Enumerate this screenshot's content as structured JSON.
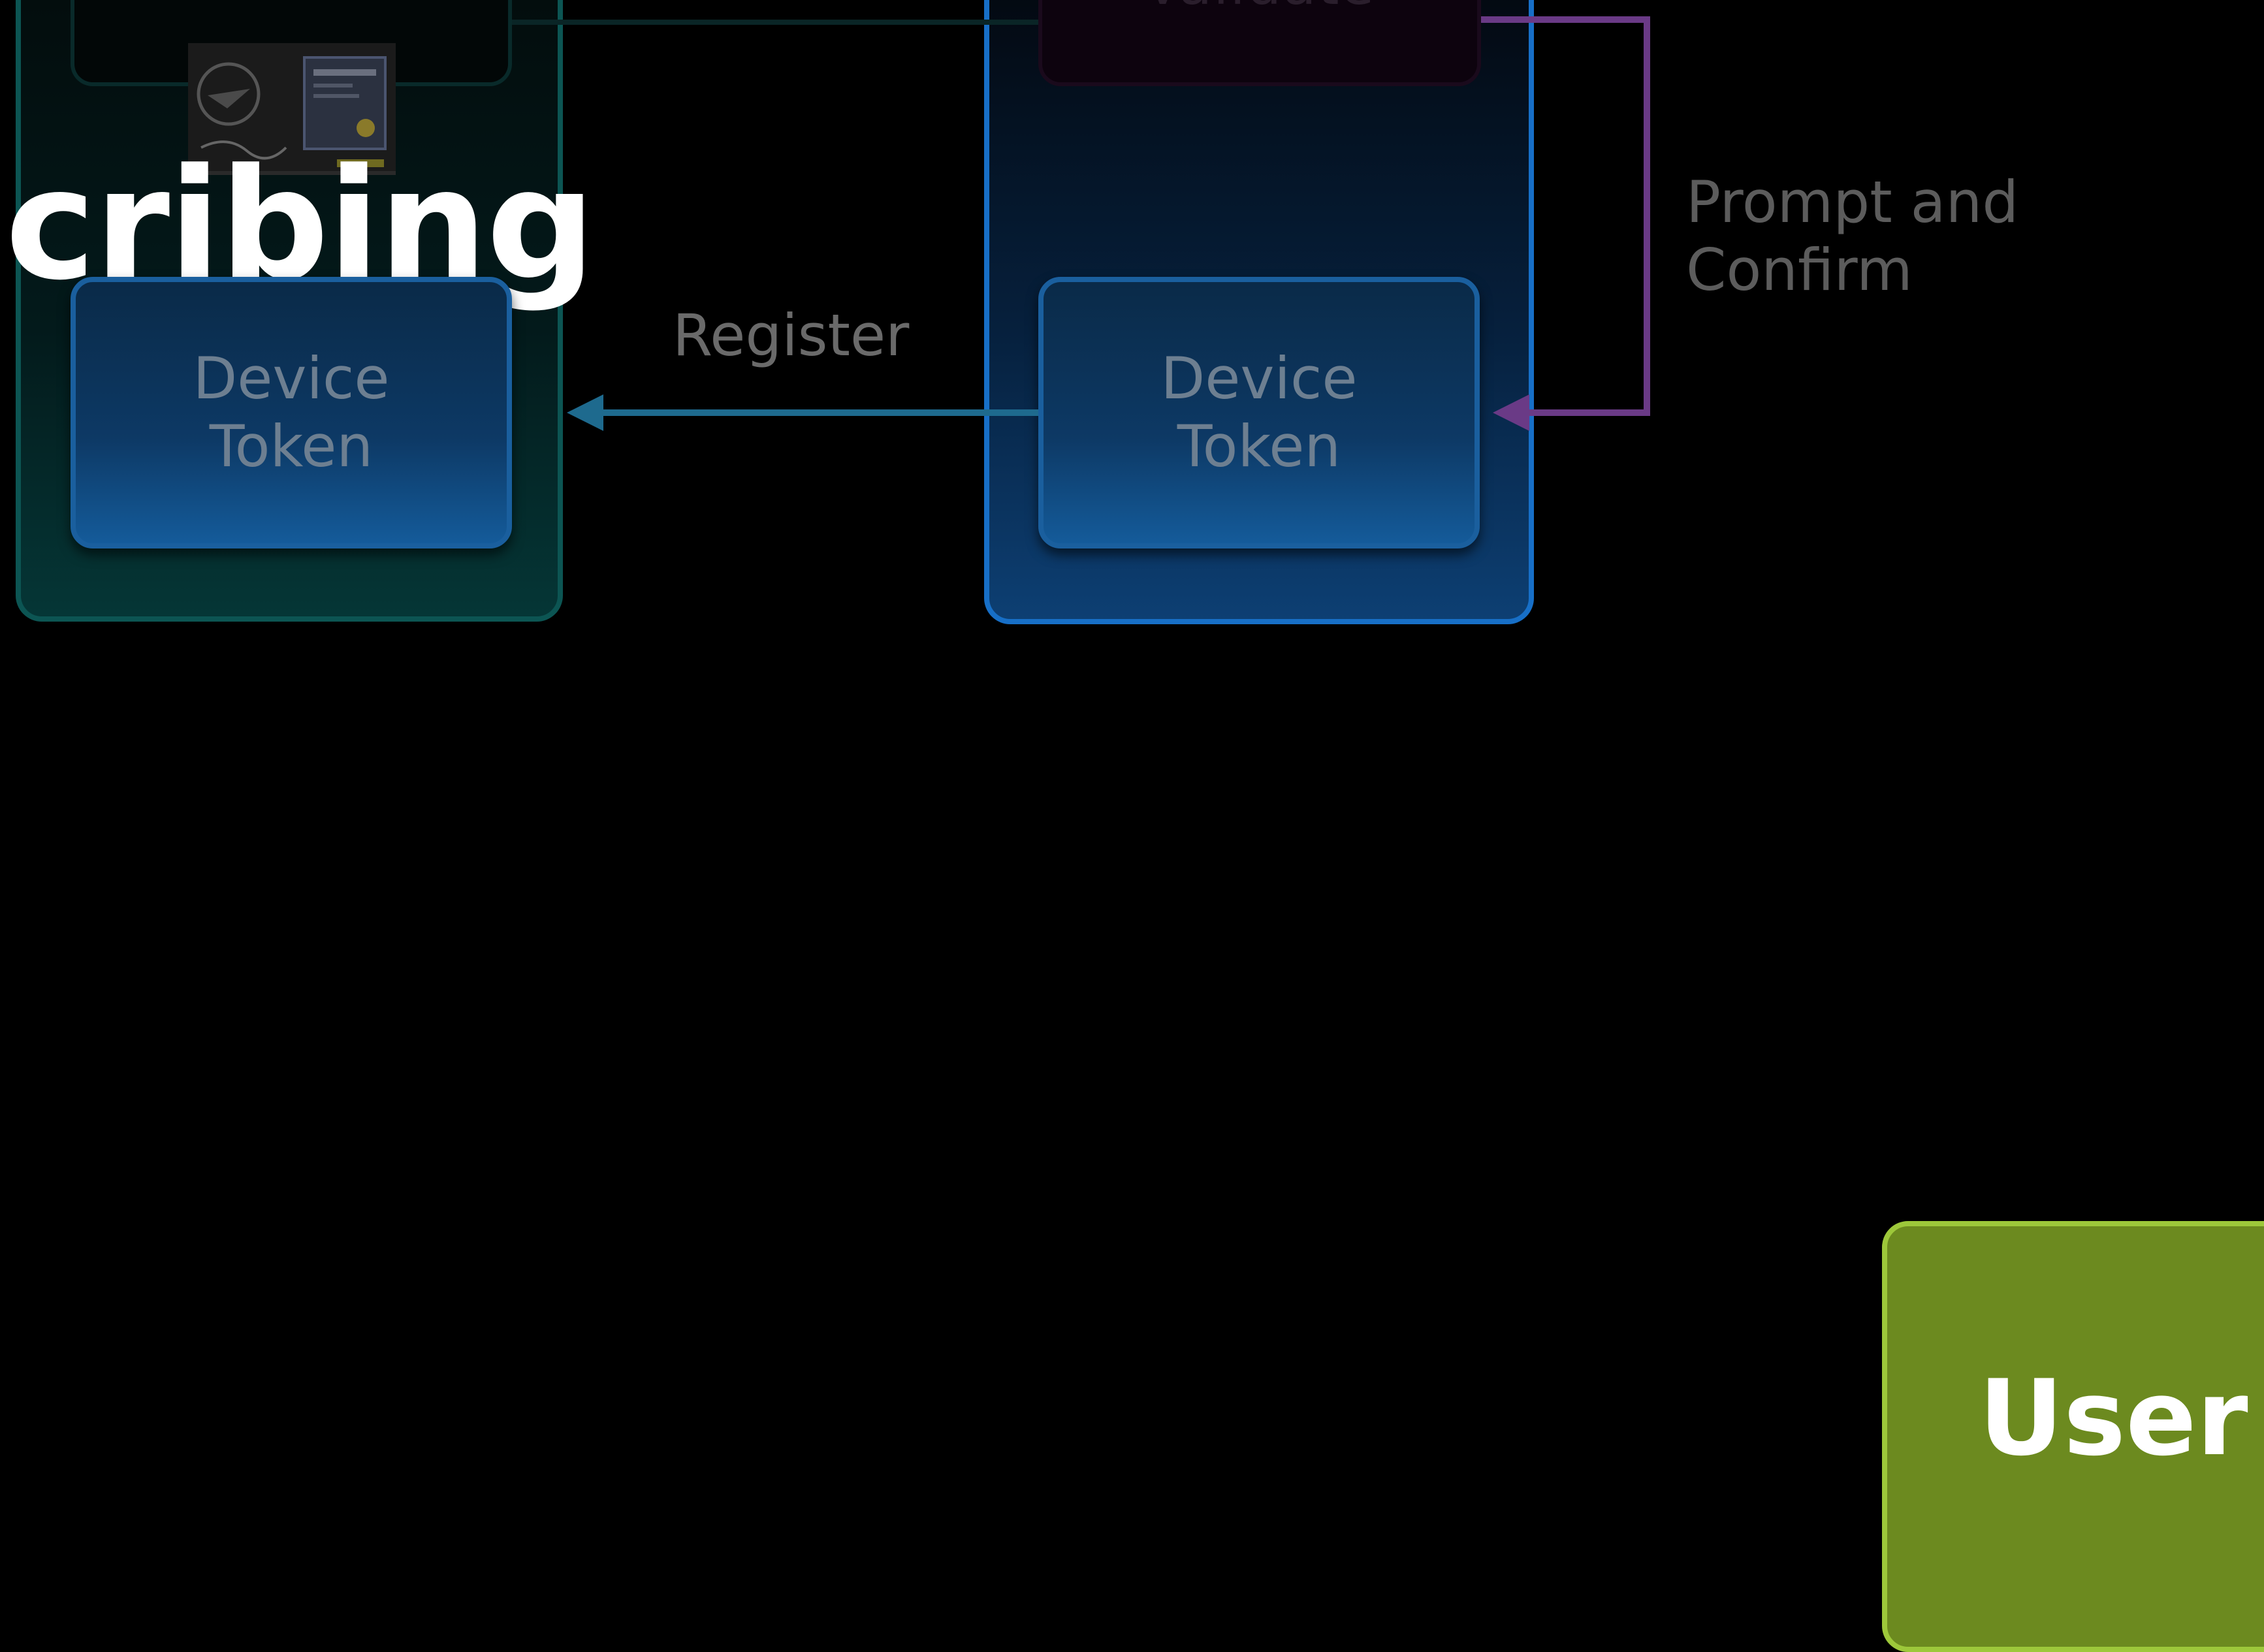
{
  "diagram": {
    "headline": "cribing",
    "top_right_label": "Validate",
    "left_token": {
      "line1": "Device",
      "line2": "Token"
    },
    "right_token": {
      "line1": "Device",
      "line2": "Token"
    },
    "register_label": "Register",
    "prompt_label": {
      "line1": "Prompt and",
      "line2": "Confirm"
    },
    "user_label": "User"
  },
  "colors": {
    "background": "#000000",
    "left_panel_border": "#0c5553",
    "right_panel_border": "#176fc7",
    "token_fill": "#0d3965",
    "register_arrow": "#1e6a8e",
    "prompt_arrow": "#6a3a86",
    "user_fill": "#6c8a1f",
    "user_border": "#9dc83a"
  }
}
